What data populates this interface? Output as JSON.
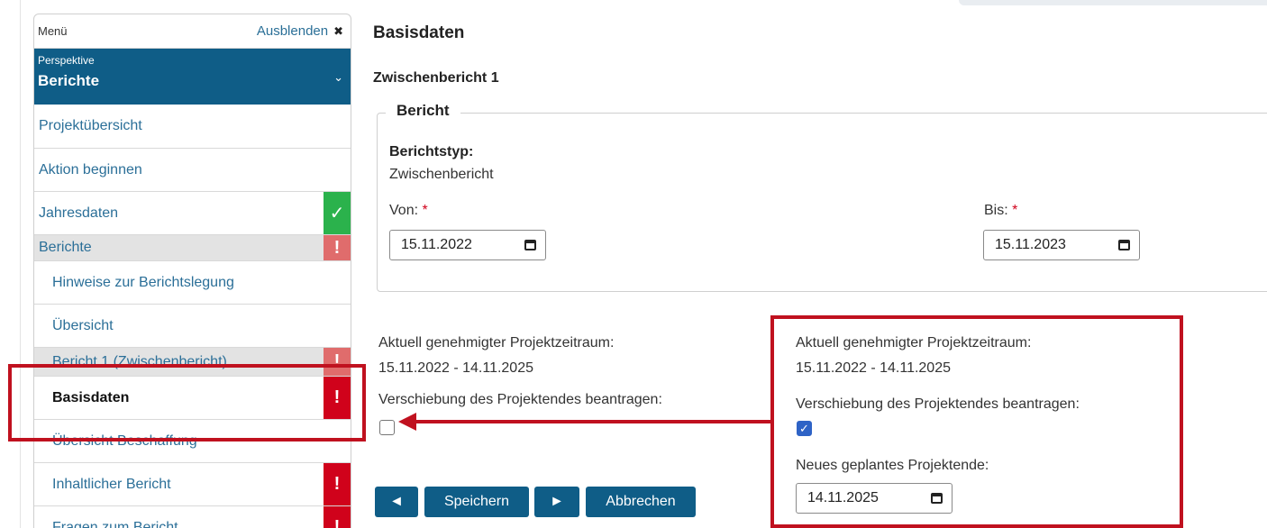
{
  "sidebar": {
    "menu_label": "Menü",
    "hide_label": "Ausblenden",
    "perspective_small": "Perspektive",
    "perspective_value": "Berichte",
    "items": [
      {
        "label": "Projektübersicht"
      },
      {
        "label": "Aktion beginnen"
      },
      {
        "label": "Jahresdaten",
        "badge": "✓"
      },
      {
        "label": "Berichte",
        "badge": "!"
      },
      {
        "label": "Hinweise zur Berichtslegung"
      },
      {
        "label": "Übersicht"
      },
      {
        "label": "Bericht 1 (Zwischenbericht)",
        "badge": "!"
      },
      {
        "label": "Basisdaten",
        "badge": "!"
      },
      {
        "label": "Übersicht Beschaffung"
      },
      {
        "label": "Inhaltlicher Bericht",
        "badge": "!"
      },
      {
        "label": "Fragen zum Bericht",
        "badge": "!"
      }
    ]
  },
  "main": {
    "title": "Basisdaten",
    "subtitle": "Zwischenbericht 1",
    "fieldset_legend": "Bericht",
    "report_type_label": "Berichtstyp:",
    "report_type_value": "Zwischenbericht",
    "from_label": "Von:",
    "from_value": "15.11.2022",
    "to_label": "Bis:",
    "to_value": "15.11.2023",
    "required_marker": "*"
  },
  "period_left": {
    "label": "Aktuell genehmigter Projektzeitraum:",
    "value": "15.11.2022 - 14.11.2025",
    "postpone_label": "Verschiebung des Projektendes beantragen:",
    "checked": false
  },
  "period_right": {
    "label": "Aktuell genehmigter Projektzeitraum:",
    "value": "15.11.2022 - 14.11.2025",
    "postpone_label": "Verschiebung des Projektendes beantragen:",
    "checked": true,
    "new_end_label": "Neues geplantes Projektende:",
    "new_end_value": "14.11.2025"
  },
  "buttons": {
    "prev": "◄",
    "save": "Speichern",
    "next": "►",
    "cancel": "Abbrechen"
  },
  "colors": {
    "brand": "#0f5d87",
    "link": "#2b6f98",
    "error": "#d0021b",
    "ok": "#2bb24c",
    "annotation": "#c0111f"
  }
}
